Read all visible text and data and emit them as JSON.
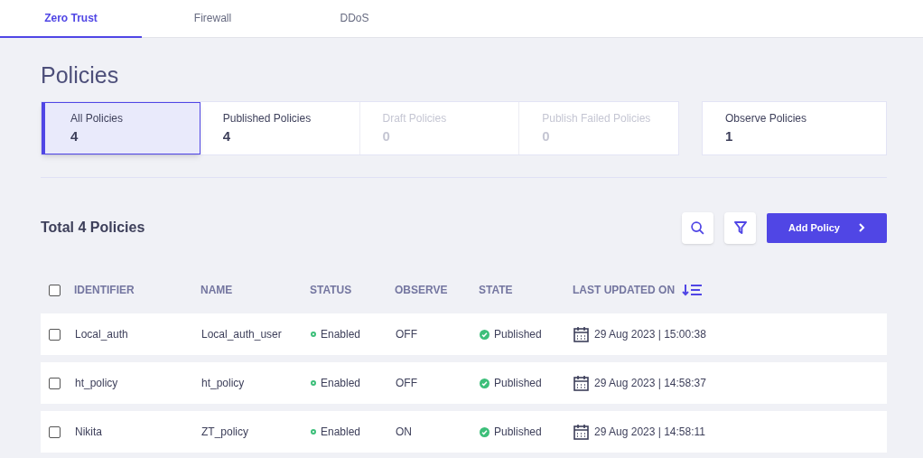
{
  "tabs": [
    {
      "label": "Zero Trust",
      "selected": true
    },
    {
      "label": "Firewall",
      "selected": false
    },
    {
      "label": "DDoS",
      "selected": false
    }
  ],
  "page_title": "Policies",
  "summary_group": [
    {
      "label": "All Policies",
      "count": "4",
      "selected": true,
      "disabled": false
    },
    {
      "label": "Published Policies",
      "count": "4",
      "selected": false,
      "disabled": false
    },
    {
      "label": "Draft Policies",
      "count": "0",
      "selected": false,
      "disabled": true
    },
    {
      "label": "Publish Failed Policies",
      "count": "0",
      "selected": false,
      "disabled": true
    }
  ],
  "observe_card": {
    "label": "Observe Policies",
    "count": "1"
  },
  "total_title": "Total 4 Policies",
  "add_button": "Add Policy",
  "table": {
    "select_all_checked": false,
    "columns": [
      "IDENTIFIER",
      "NAME",
      "STATUS",
      "OBSERVE",
      "STATE",
      "LAST UPDATED ON"
    ],
    "rows": [
      {
        "checked": false,
        "identifier": "Local_auth",
        "name": "Local_auth_user",
        "status": "Enabled",
        "observe": "OFF",
        "state": "Published",
        "updated": "29 Aug 2023 | 15:00:38"
      },
      {
        "checked": false,
        "identifier": "ht_policy",
        "name": "ht_policy",
        "status": "Enabled",
        "observe": "OFF",
        "state": "Published",
        "updated": "29 Aug 2023 | 14:58:37"
      },
      {
        "checked": false,
        "identifier": "Nikita",
        "name": "ZT_policy",
        "status": "Enabled",
        "observe": "ON",
        "state": "Published",
        "updated": "29 Aug 2023 | 14:58:11"
      }
    ]
  }
}
